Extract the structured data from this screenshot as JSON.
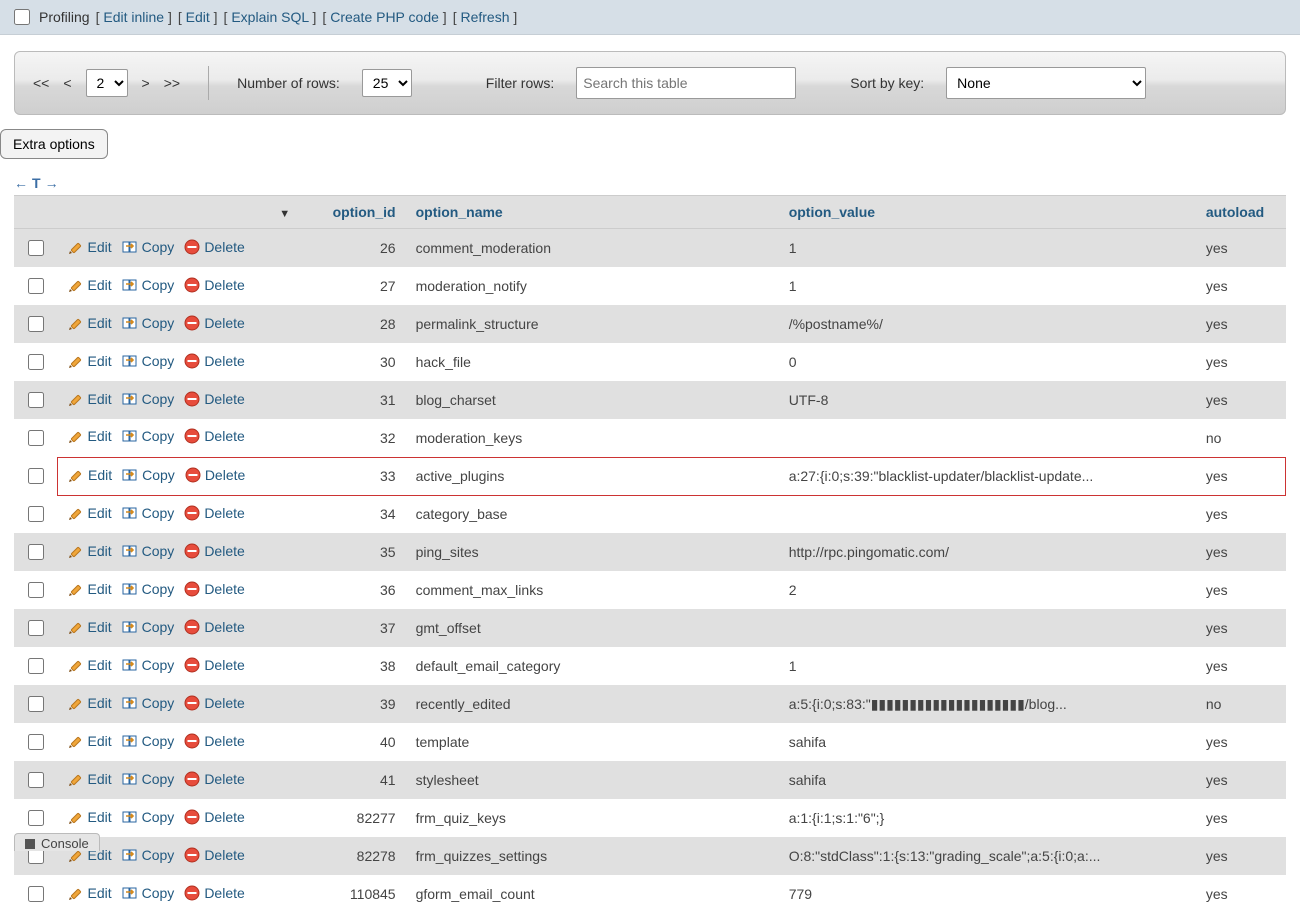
{
  "topbar": {
    "profiling": "Profiling",
    "links": [
      "Edit inline",
      "Edit",
      "Explain SQL",
      "Create PHP code",
      "Refresh"
    ]
  },
  "nav": {
    "first": "<<",
    "prev": "<",
    "page": "2",
    "next": ">",
    "last": ">>",
    "rowsLabel": "Number of rows:",
    "rowsValue": "25",
    "filterLabel": "Filter rows:",
    "filterPlaceholder": "Search this table",
    "sortLabel": "Sort by key:",
    "sortValue": "None"
  },
  "extraOptions": "Extra options",
  "columns": {
    "option_id": "option_id",
    "option_name": "option_name",
    "option_value": "option_value",
    "autoload": "autoload"
  },
  "actions": {
    "edit": "Edit",
    "copy": "Copy",
    "delete": "Delete"
  },
  "highlightId": 33,
  "rows": [
    {
      "id": 26,
      "name": "comment_moderation",
      "value": "1",
      "autoload": "yes"
    },
    {
      "id": 27,
      "name": "moderation_notify",
      "value": "1",
      "autoload": "yes"
    },
    {
      "id": 28,
      "name": "permalink_structure",
      "value": "/%postname%/",
      "autoload": "yes"
    },
    {
      "id": 30,
      "name": "hack_file",
      "value": "0",
      "autoload": "yes"
    },
    {
      "id": 31,
      "name": "blog_charset",
      "value": "UTF-8",
      "autoload": "yes"
    },
    {
      "id": 32,
      "name": "moderation_keys",
      "value": "",
      "autoload": "no"
    },
    {
      "id": 33,
      "name": "active_plugins",
      "value": "a:27:{i:0;s:39:\"blacklist-updater/blacklist-update...",
      "autoload": "yes"
    },
    {
      "id": 34,
      "name": "category_base",
      "value": "",
      "autoload": "yes"
    },
    {
      "id": 35,
      "name": "ping_sites",
      "value": "http://rpc.pingomatic.com/",
      "autoload": "yes"
    },
    {
      "id": 36,
      "name": "comment_max_links",
      "value": "2",
      "autoload": "yes"
    },
    {
      "id": 37,
      "name": "gmt_offset",
      "value": "",
      "autoload": "yes"
    },
    {
      "id": 38,
      "name": "default_email_category",
      "value": "1",
      "autoload": "yes"
    },
    {
      "id": 39,
      "name": "recently_edited",
      "value": "a:5:{i:0;s:83:\"▮▮▮▮▮▮▮▮▮▮▮▮▮▮▮▮▮▮▮▮/blog...",
      "autoload": "no"
    },
    {
      "id": 40,
      "name": "template",
      "value": "sahifa",
      "autoload": "yes"
    },
    {
      "id": 41,
      "name": "stylesheet",
      "value": "sahifa",
      "autoload": "yes"
    },
    {
      "id": 82277,
      "name": "frm_quiz_keys",
      "value": "a:1:{i:1;s:1:\"6\";}",
      "autoload": "yes"
    },
    {
      "id": 82278,
      "name": "frm_quizzes_settings",
      "value": "O:8:\"stdClass\":1:{s:13:\"grading_scale\";a:5:{i:0;a:...",
      "autoload": "yes"
    },
    {
      "id": 110845,
      "name": "gform_email_count",
      "value": "779",
      "autoload": "yes"
    }
  ],
  "console": "Console"
}
